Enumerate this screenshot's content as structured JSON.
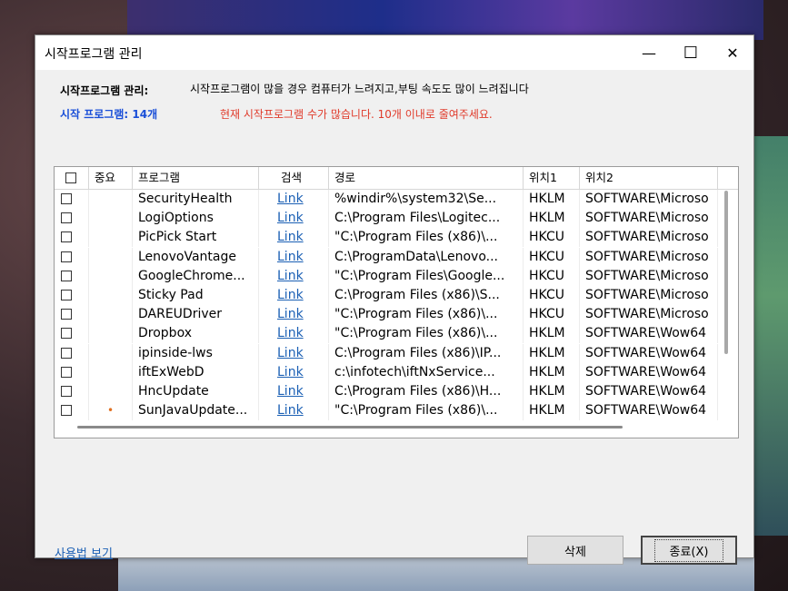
{
  "window": {
    "title": "시작프로그램 관리",
    "minimize_glyph": "—",
    "maximize_glyph": "☐",
    "close_glyph": "✕"
  },
  "header": {
    "label": "시작프로그램 관리:",
    "description": "시작프로그램이 많을 경우 컴퓨터가 느려지고,부팅 속도도 많이 느려집니다",
    "count_label": "시작 프로그램: 14개",
    "warning": "현재 시작프로그램 수가 많습니다. 10개 이내로 줄여주세요."
  },
  "colors": {
    "count_blue": "#1a4fd8",
    "warning_red": "#e03a2a",
    "link_blue": "#1a5fb4",
    "important_dot": "#e07020"
  },
  "table": {
    "columns": [
      "중요",
      "프로그램",
      "검색",
      "경로",
      "위치1",
      "위치2"
    ],
    "rows": [
      {
        "important": "",
        "program": "SecurityHealth",
        "search": "Link",
        "path": "%windir%\\system32\\Se...",
        "loc1": "HKLM",
        "loc2": "SOFTWARE\\Microso"
      },
      {
        "important": "",
        "program": "LogiOptions",
        "search": "Link",
        "path": "C:\\Program Files\\Logitec...",
        "loc1": "HKLM",
        "loc2": "SOFTWARE\\Microso"
      },
      {
        "important": "",
        "program": "PicPick Start",
        "search": "Link",
        "path": "\"C:\\Program Files (x86)\\...",
        "loc1": "HKCU",
        "loc2": "SOFTWARE\\Microso"
      },
      {
        "important": "",
        "program": "LenovoVantage",
        "search": "Link",
        "path": "C:\\ProgramData\\Lenovo...",
        "loc1": "HKCU",
        "loc2": "SOFTWARE\\Microso"
      },
      {
        "important": "",
        "program": "GoogleChrome...",
        "search": "Link",
        "path": "\"C:\\Program Files\\Google...",
        "loc1": "HKCU",
        "loc2": "SOFTWARE\\Microso"
      },
      {
        "important": "",
        "program": "Sticky Pad",
        "search": "Link",
        "path": "C:\\Program Files (x86)\\S...",
        "loc1": "HKCU",
        "loc2": "SOFTWARE\\Microso"
      },
      {
        "important": "",
        "program": "DAREUDriver",
        "search": "Link",
        "path": "\"C:\\Program Files (x86)\\...",
        "loc1": "HKCU",
        "loc2": "SOFTWARE\\Microso"
      },
      {
        "important": "",
        "program": "Dropbox",
        "search": "Link",
        "path": "\"C:\\Program Files (x86)\\...",
        "loc1": "HKLM",
        "loc2": "SOFTWARE\\Wow64"
      },
      {
        "important": "",
        "program": "ipinside-lws",
        "search": "Link",
        "path": "C:\\Program Files (x86)\\IP...",
        "loc1": "HKLM",
        "loc2": "SOFTWARE\\Wow64"
      },
      {
        "important": "",
        "program": "iftExWebD",
        "search": "Link",
        "path": "c:\\infotech\\iftNxService...",
        "loc1": "HKLM",
        "loc2": "SOFTWARE\\Wow64"
      },
      {
        "important": "",
        "program": "HncUpdate",
        "search": "Link",
        "path": "C:\\Program Files (x86)\\H...",
        "loc1": "HKLM",
        "loc2": "SOFTWARE\\Wow64"
      },
      {
        "important": "•",
        "program": "SunJavaUpdate...",
        "search": "Link",
        "path": "\"C:\\Program Files (x86)\\...",
        "loc1": "HKLM",
        "loc2": "SOFTWARE\\Wow64"
      }
    ]
  },
  "footer": {
    "help_link": "사용법 보기",
    "delete_button": "삭제",
    "exit_button": "종료(X)"
  }
}
